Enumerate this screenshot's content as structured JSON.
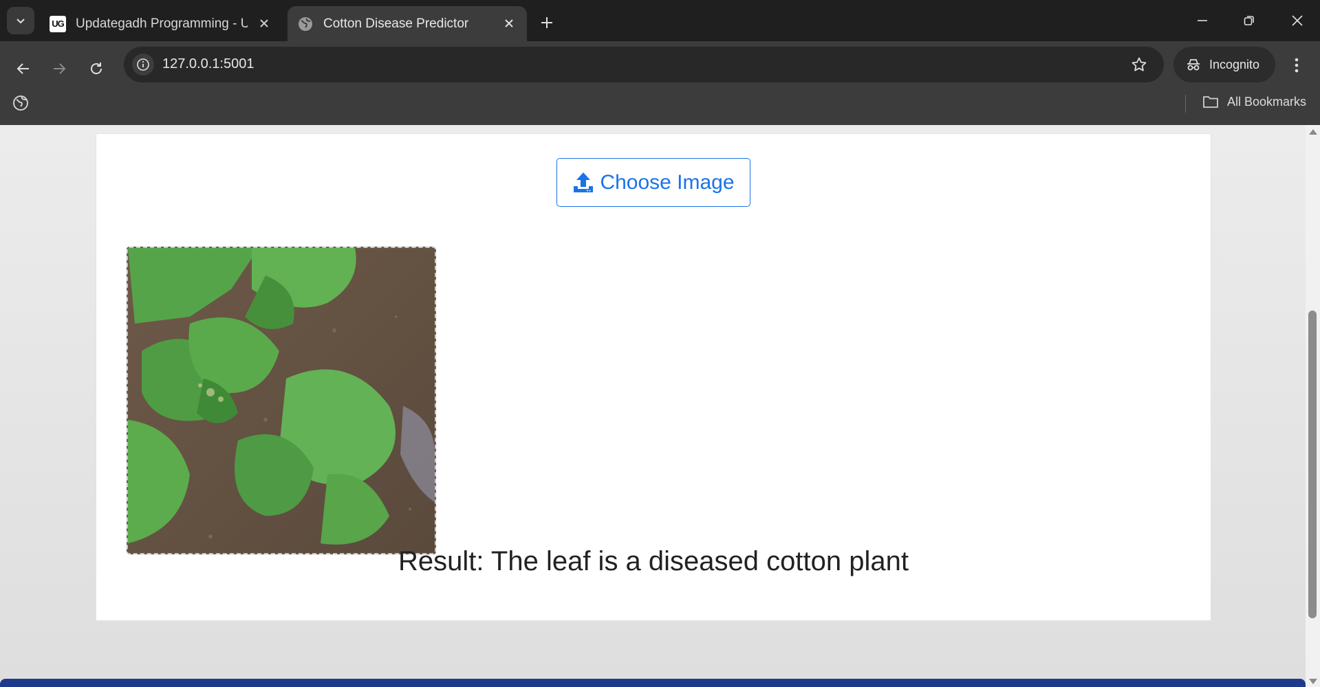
{
  "browser": {
    "tabs": [
      {
        "title": "Updategadh Programming - Up",
        "favicon": "ug-logo-icon",
        "active": false
      },
      {
        "title": "Cotton Disease Predictor",
        "favicon": "globe-icon",
        "active": true
      }
    ],
    "url": "127.0.0.1:5001",
    "incognito_label": "Incognito",
    "bookmarks_label": "All Bookmarks",
    "favicon_text": "UG"
  },
  "page": {
    "upload_button_label": "Choose Image",
    "result_text": "Result: The leaf is a diseased cotton plant",
    "accent_color": "#1a73e8",
    "footer_color": "#1e3a8a"
  }
}
